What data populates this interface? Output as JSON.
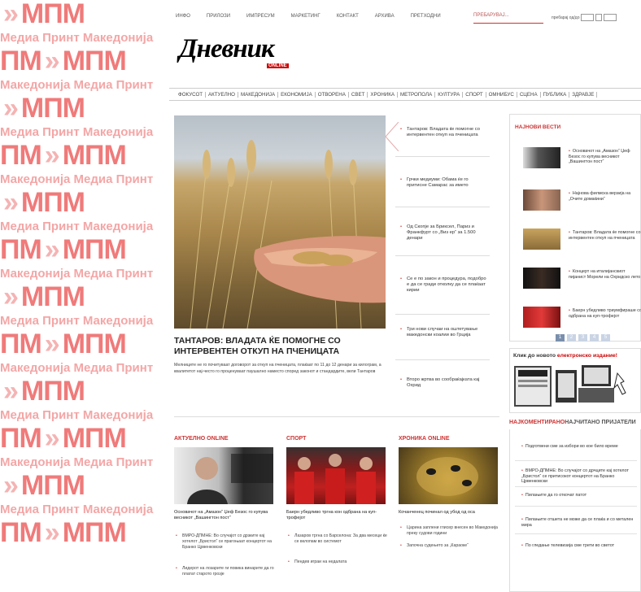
{
  "banner": {
    "logo_mpm": "МПМ",
    "logo_pm": "ПМ",
    "chev": "»",
    "tagline": "Медиа Принт Македонија",
    "tagline_alt": "Македонија Медиа Принт"
  },
  "topnav": {
    "links": [
      "ИНФО",
      "ПРИЛОЗИ",
      "ИМПРЕСУМ",
      "МАРКЕТИНГ",
      "КОНТАКТ",
      "АРХИВА",
      "ПРЕТХОДНИ"
    ],
    "search_placeholder": "ПРЕБАРУВАЈ...",
    "date_search_label": "пребарај од/до"
  },
  "logo": {
    "name": "Дневник",
    "badge": "ONLINE"
  },
  "categories": [
    "ФОКУСОТ",
    "АКТУЕЛНО",
    "МАКЕДОНИЈА",
    "ЕКОНОМИЈА",
    "ОТВОРЕНА",
    "СВЕТ",
    "ХРОНИКА",
    "МЕТРОПОЛА",
    "КУЛТУРА",
    "СПОРТ",
    "ОМНИБУС",
    "СЦЕНА",
    "ПУБЛИКА",
    "ЗДРАВЈЕ"
  ],
  "featured": {
    "title": "ТАНТАРОВ: ВЛАДАТА ЌЕ ПОМОГНЕ СО ИНТЕРВЕНТЕН ОТКУП НА ПЧЕНИЦАТА",
    "text": "Мелниците не го почитуваат договорот за откуп на пченицата, плаќаат по 11 до 12 денари за килограм, а квалитетот нај-често го проценуваат паушално наместо според законот и стандардите, вели Тантаров"
  },
  "headlines": [
    "Тантаров: Владата ќе помогне со интервентен откуп на пченицата",
    "Грчки медиуми: Обама ќе го притисне Самарас за името",
    "Од Скопје за Бриксел, Париз и Франкфурт со „Виз ер“ за 1.500 денари",
    "Се е по закон и процедура, подобро е да се гради отколку да се плаќаат кирии",
    "Три нови случаи на оштетување македонски коалии во Грција",
    "Второ жртва во сообраќајката кај Охрид"
  ],
  "sidebar": {
    "latest_title": "НАЈНОВИ ВЕСТИ",
    "latest": [
      "Основачот на „Амазон“ Џеф Безос го купува весникот „Вашингтон пост“",
      "Најнова филмска верзија на „Очите домаќини“",
      "Тантаров: Владата ќе помогне со интервентен откуп на пченицата",
      "Концерт на италијанскиот пијанист Морели на Охридско лето",
      "Баерн убедливо триумфираше со одбрана на куп-трофејот"
    ],
    "pages": [
      "1",
      "2",
      "3",
      "4",
      "5"
    ],
    "epaper_prefix": "Клик до новото",
    "epaper_highlight": "електронско издание!",
    "most_tab_active": "НАЈКОМЕНТИРАНО",
    "most_tab_other": "НАЈЧИТАНО ПРИЈАТЕЛИ",
    "most": [
      "Подготвени сме за избори во кое било време",
      "ВМРО-ДПМНЕ: Во случајот со дрчците кај хотелот „Бристол“ се притисокот концертот на Бранко Црвенковски",
      "Пилањите да го откочат патот",
      "Пилањите отшета не може да се плаќа и со метален мира",
      "По гледање телевизија сме трети во светот"
    ]
  },
  "columns": [
    {
      "head": "АКТУЕЛНО ONLINE",
      "title": "Основачот на „Амазон“ Џеф Безос го купува весникот „Вашингтон пост“",
      "items": [
        "ВМРО-ДПМНЕ: Во случајот со дрзките кај хотелот „Бристол“ се прагоњаат концертот на Бранко Црвенковски",
        "Лидерот на лозарите ги повика винарите да го платат старото грозје"
      ]
    },
    {
      "head": "СПОРТ",
      "title": "Баерн убедливо тргна кон одбрана на куп-трофејот",
      "items": [
        "Лазаров тргна со Барселона: За два месеци ќе се вклопам во системот",
        "Пендев играи на недалата"
      ]
    },
    {
      "head": "ХРОНИКА ONLINE",
      "title": "Кочанченец починал од убод од оса",
      "items": [
        "Царина заплени глисер внесен во Македонија преку судови години",
        "Започна судењето за „Караоке“"
      ]
    }
  ]
}
